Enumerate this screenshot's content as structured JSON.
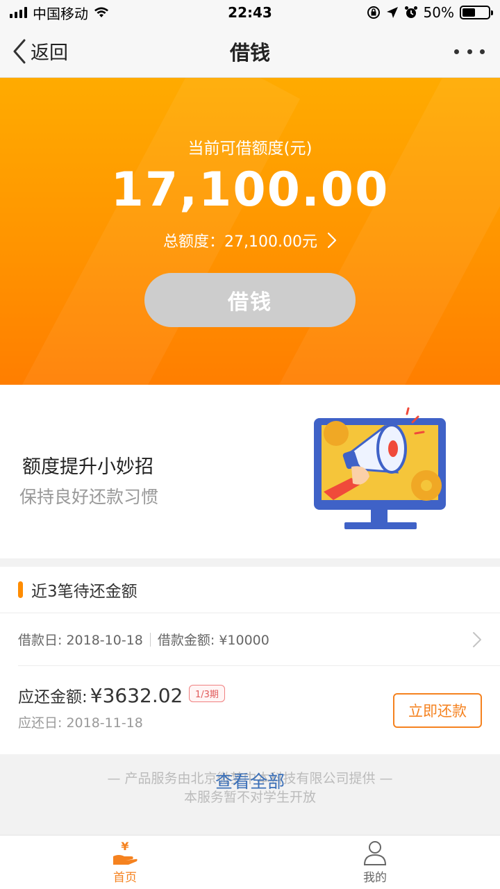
{
  "status_bar": {
    "carrier": "中国移动",
    "time": "22:43",
    "battery": "50%",
    "battery_level": 0.5
  },
  "nav": {
    "back_label": "返回",
    "title": "借钱"
  },
  "hero": {
    "label": "当前可借额度(元)",
    "amount": "17,100.00",
    "total_label": "总额度：",
    "total_value": "27,100.00元",
    "button_label": "借钱"
  },
  "promo": {
    "title": "额度提升小妙招",
    "subtitle": "保持良好还款习惯"
  },
  "repay": {
    "section_title": "近3笔待还金额",
    "loan_date": "借款日: 2018-10-18",
    "loan_amount": "借款金额: ¥10000",
    "due_label": "应还金额: ",
    "due_amount": "¥3632.02",
    "period": "1/3期",
    "due_date": "应还日: 2018-11-18",
    "pay_button": "立即还款"
  },
  "footer": {
    "view_all": "查看全部",
    "line1": "— 产品服务由北京微梦中本科技有限公司提供 —",
    "line2": "本服务暂不对学生开放"
  },
  "tabs": [
    {
      "label": "首页",
      "active": true
    },
    {
      "label": "我的",
      "active": false
    }
  ],
  "colors": {
    "accent": "#f5821f",
    "hero_top": "#ffab00",
    "hero_bottom": "#ff7e00",
    "link": "#3a6fb8"
  }
}
